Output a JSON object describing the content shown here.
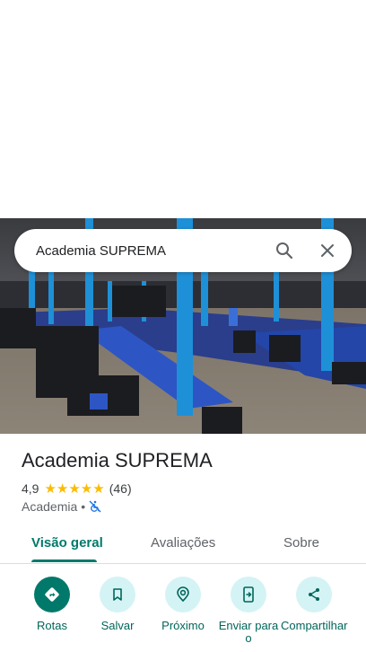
{
  "search": {
    "query": "Academia SUPREMA"
  },
  "place": {
    "name": "Academia SUPREMA",
    "rating": "4,9",
    "stars": "★★★★★",
    "review_count": "(46)",
    "category": "Academia",
    "separator": "•"
  },
  "tabs": [
    {
      "label": "Visão geral"
    },
    {
      "label": "Avaliações"
    },
    {
      "label": "Sobre"
    }
  ],
  "actions": [
    {
      "label": "Rotas"
    },
    {
      "label": "Salvar"
    },
    {
      "label": "Próximo"
    },
    {
      "label": "Enviar para o"
    },
    {
      "label": "Compartilhar"
    }
  ],
  "colors": {
    "accent": "#00796b",
    "action_bg": "#d4f3f5",
    "star": "#fbbc04"
  }
}
